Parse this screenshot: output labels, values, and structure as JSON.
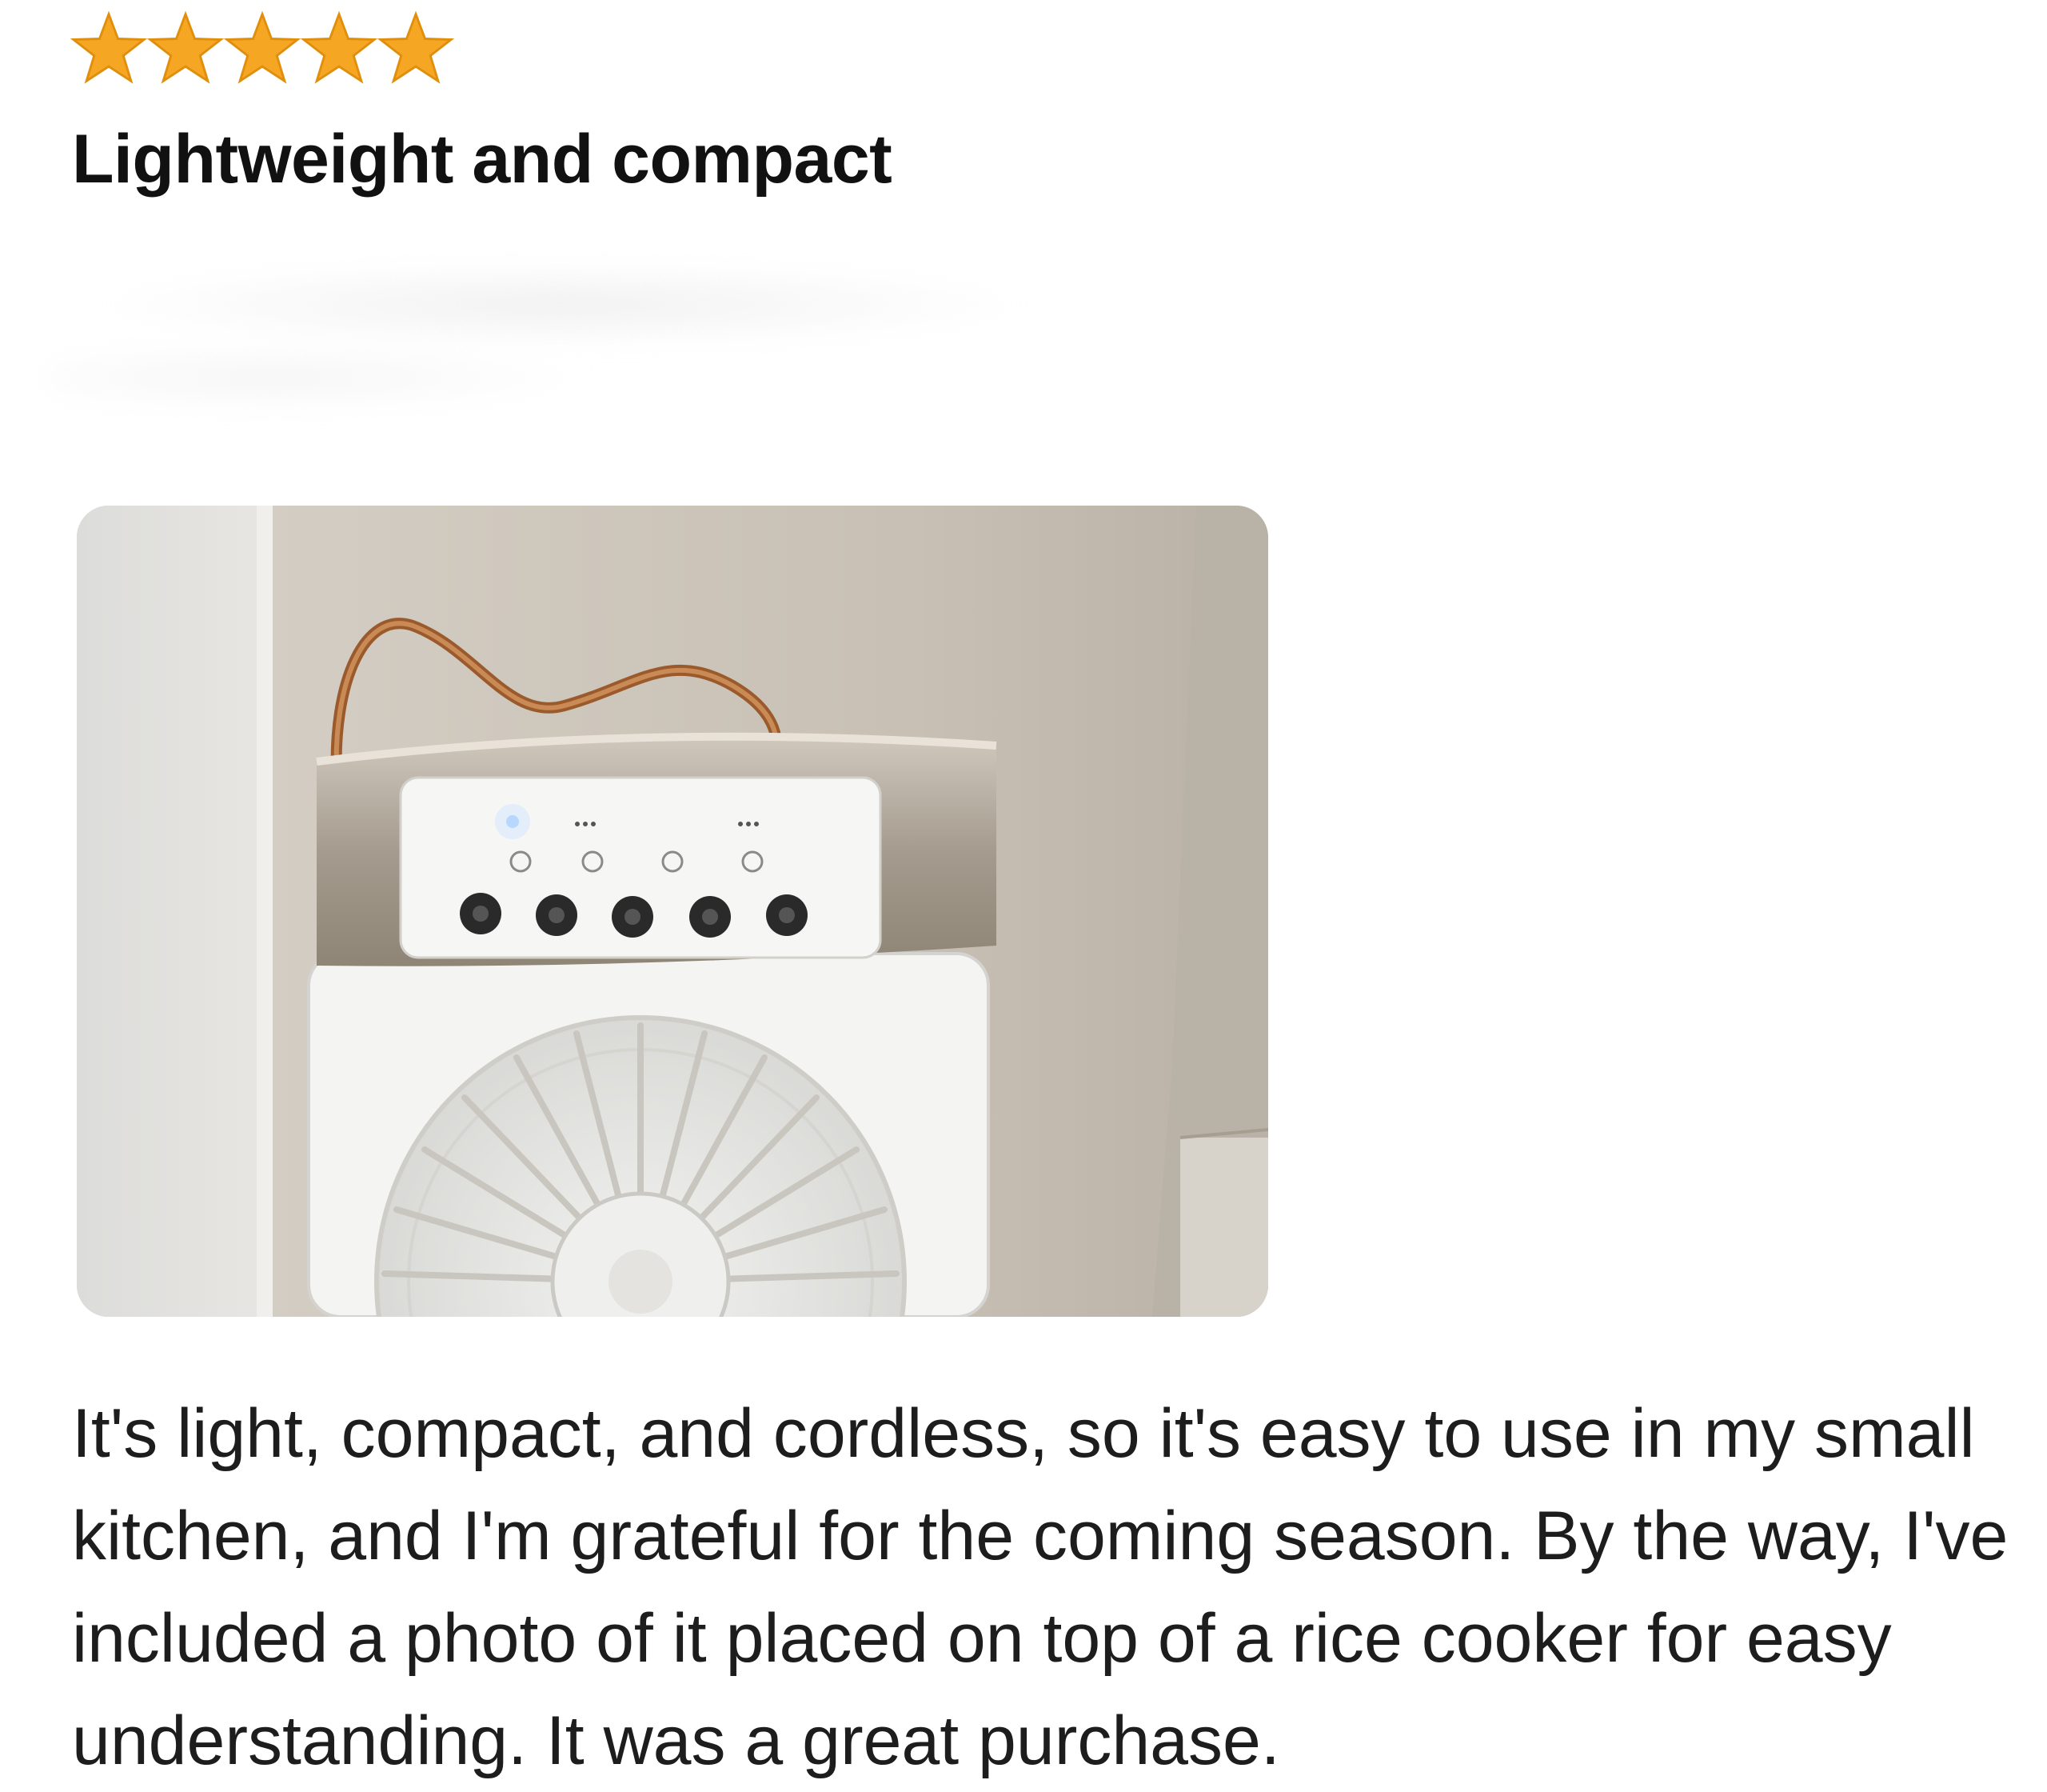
{
  "review": {
    "rating": 5,
    "rating_max": 5,
    "star_color": "#F5A623",
    "title": "Lightweight and compact",
    "image": {
      "icon": "review-photo-portable-fan-cooler"
    },
    "body": "It's light, compact, and cordless, so it's easy to use in my small kitchen, and I'm grateful for the coming season. By the way, I've included a photo of it placed on top of a rice cooker for easy understanding. It was a great purchase."
  }
}
